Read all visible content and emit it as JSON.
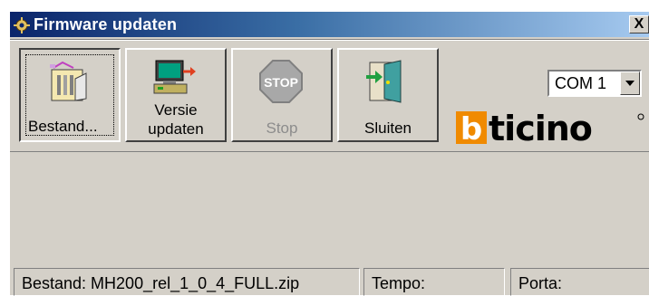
{
  "window": {
    "title": "Firmware updaten",
    "close_label": "X"
  },
  "toolbar": {
    "buttons": [
      {
        "label": "Bestand...",
        "icon": "file-open-icon",
        "enabled": true
      },
      {
        "label_line1": "Versie",
        "label_line2": "updaten",
        "icon": "computer-upload-icon",
        "enabled": true
      },
      {
        "label": "Stop",
        "icon": "stop-sign-icon",
        "enabled": false
      },
      {
        "label": "Sluiten",
        "icon": "exit-door-icon",
        "enabled": true
      }
    ]
  },
  "port_select": {
    "value": "COM 1"
  },
  "brand": {
    "name": "bticino",
    "colors": {
      "accent": "#f08a00",
      "dark": "#000000"
    }
  },
  "statusbar": {
    "file": "Bestand: MH200_rel_1_0_4_FULL.zip",
    "tempo": "Tempo:",
    "porta": "Porta:"
  },
  "colors": {
    "title_start": "#0a246a",
    "title_end": "#a6caf0",
    "face": "#d4d0c8"
  }
}
